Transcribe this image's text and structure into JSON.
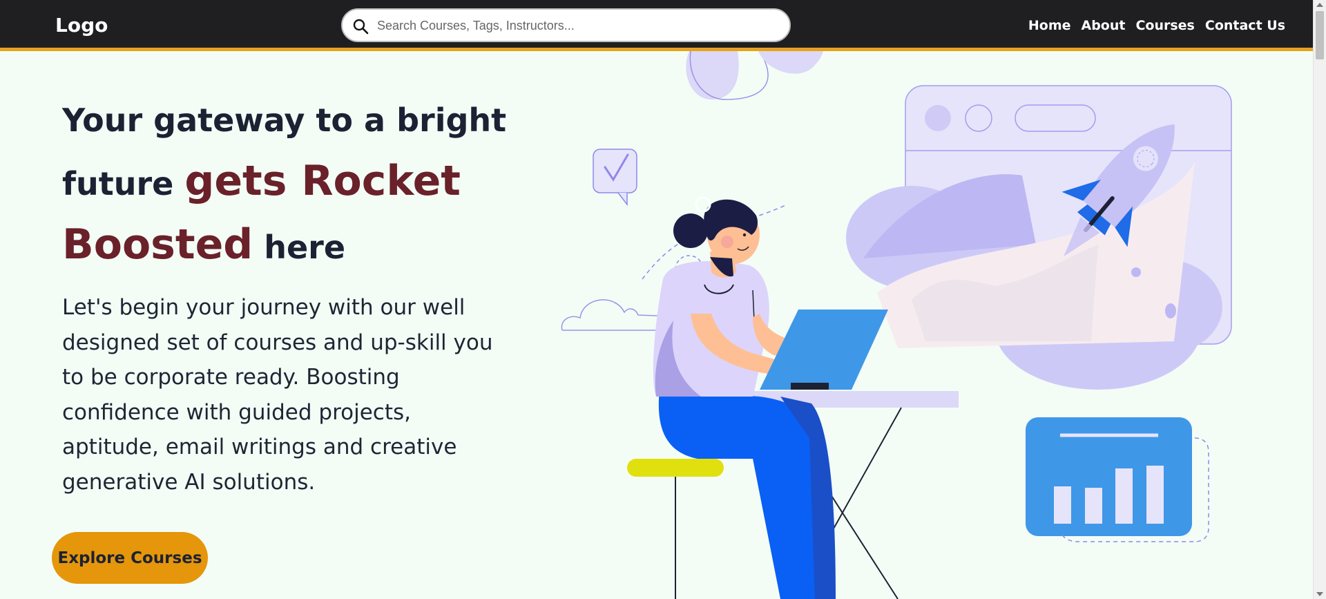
{
  "navbar": {
    "logo": "Logo",
    "search": {
      "placeholder": "Search Courses, Tags, Instructors..."
    },
    "links": [
      {
        "label": "Home"
      },
      {
        "label": "About"
      },
      {
        "label": "Courses"
      },
      {
        "label": "Contact Us"
      }
    ]
  },
  "hero": {
    "headline": {
      "part1": "Your gateway to a bright future",
      "accent": "gets Rocket Boosted",
      "part2": "here"
    },
    "description": "Let's begin your journey with our well designed set of courses and up-skill you to be corporate ready. Boosting confidence with guided projects, aptitude, email writings and creative generative AI solutions.",
    "cta_label": "Explore Courses"
  },
  "colors": {
    "navbar_bg": "#1f1f22",
    "navbar_accent_border": "#e8a11e",
    "page_bg": "#f3fdf6",
    "headline_accent": "#6a2129",
    "cta_bg": "#e5960b"
  }
}
